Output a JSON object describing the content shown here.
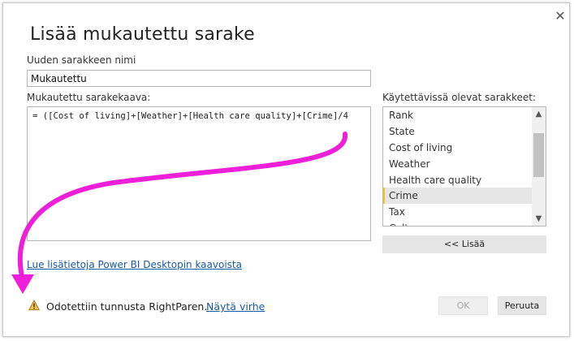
{
  "dialog": {
    "title": "Lisää mukautettu sarake",
    "close_icon": "close-icon"
  },
  "name_field": {
    "label": "Uuden sarakkeen nimi",
    "value": "Mukautettu"
  },
  "formula_field": {
    "label": "Mukautettu sarakekaava:",
    "value": "= ([Cost of living]+[Weather]+[Health care quality]+[Crime]/4"
  },
  "columns_panel": {
    "label": "Käytettävissä olevat sarakkeet:",
    "items": [
      "Rank",
      "State",
      "Cost of living",
      "Weather",
      "Health care quality",
      "Crime",
      "Tax",
      "Cult"
    ],
    "selected": "Crime",
    "add_label": "<< Lisää"
  },
  "learn_link": "Lue lisätietoja Power BI Desktopin kaavoista",
  "status": {
    "icon": "warning-icon",
    "message": "Odotettiin tunnusta RightParen.",
    "show_error_link": "Näytä virhe"
  },
  "buttons": {
    "ok": "OK",
    "cancel": "Peruuta"
  },
  "colors": {
    "annotation_arrow": "#ee1fd8",
    "selected_accent": "#f2c811",
    "link": "#1a5aa6"
  }
}
